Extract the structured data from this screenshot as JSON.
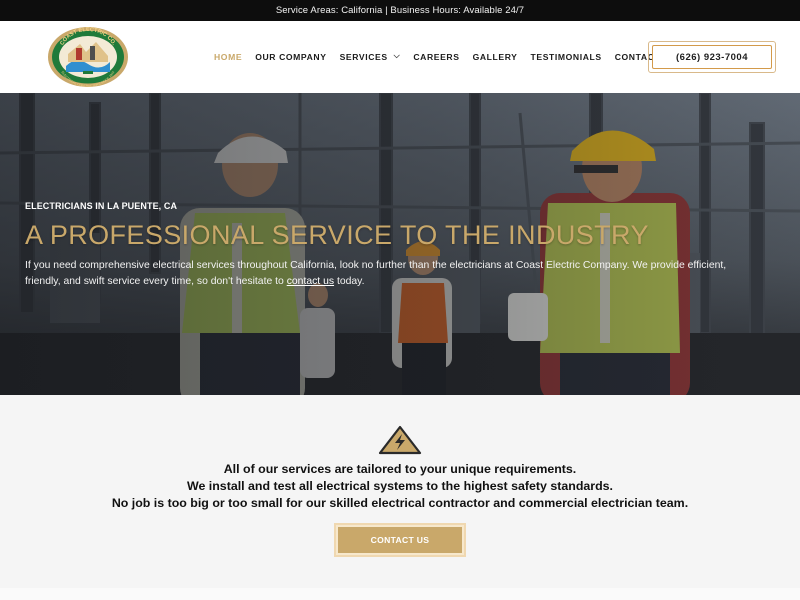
{
  "topbar": {
    "text": "Service Areas: California | Business Hours: Available 24/7"
  },
  "header": {
    "logo": {
      "ring_text_top": "COAST ELECTRIC CO.",
      "ring_text_bottom": "ELECTRICAL CONTRACTORS SINCE 1944",
      "icon": "company-seal-logo"
    },
    "nav": [
      {
        "label": "HOME",
        "active": true
      },
      {
        "label": "OUR COMPANY",
        "active": false
      },
      {
        "label": "SERVICES",
        "active": false,
        "has_dropdown": true
      },
      {
        "label": "CAREERS",
        "active": false
      },
      {
        "label": "GALLERY",
        "active": false
      },
      {
        "label": "TESTIMONIALS",
        "active": false
      },
      {
        "label": "CONTACT",
        "active": false
      }
    ],
    "phone": "(626) 923-7004"
  },
  "hero": {
    "eyebrow": "ELECTRICIANS IN LA PUENTE, CA",
    "headline": "A PROFESSIONAL SERVICE TO THE INDUSTRY",
    "lead_before_link": "If you need comprehensive electrical services throughout California, look no further than the electricians at Coast Electric Company. We provide efficient, friendly, and swift service every time, so don't hesitate to ",
    "lead_link": "contact us",
    "lead_after_link": " today."
  },
  "section": {
    "icon": "high-voltage-warning-icon",
    "lines": [
      "All of our services are tailored to your unique requirements.",
      "We install and test all electrical systems to the highest safety standards.",
      "No job is too big or too small for our skilled electrical contractor and commercial electrician team."
    ],
    "cta_label": "CONTACT US"
  },
  "colors": {
    "accent_gold": "#c9a86a",
    "phone_border": "#d39a4a",
    "topbar_bg": "#0d0d0d"
  }
}
